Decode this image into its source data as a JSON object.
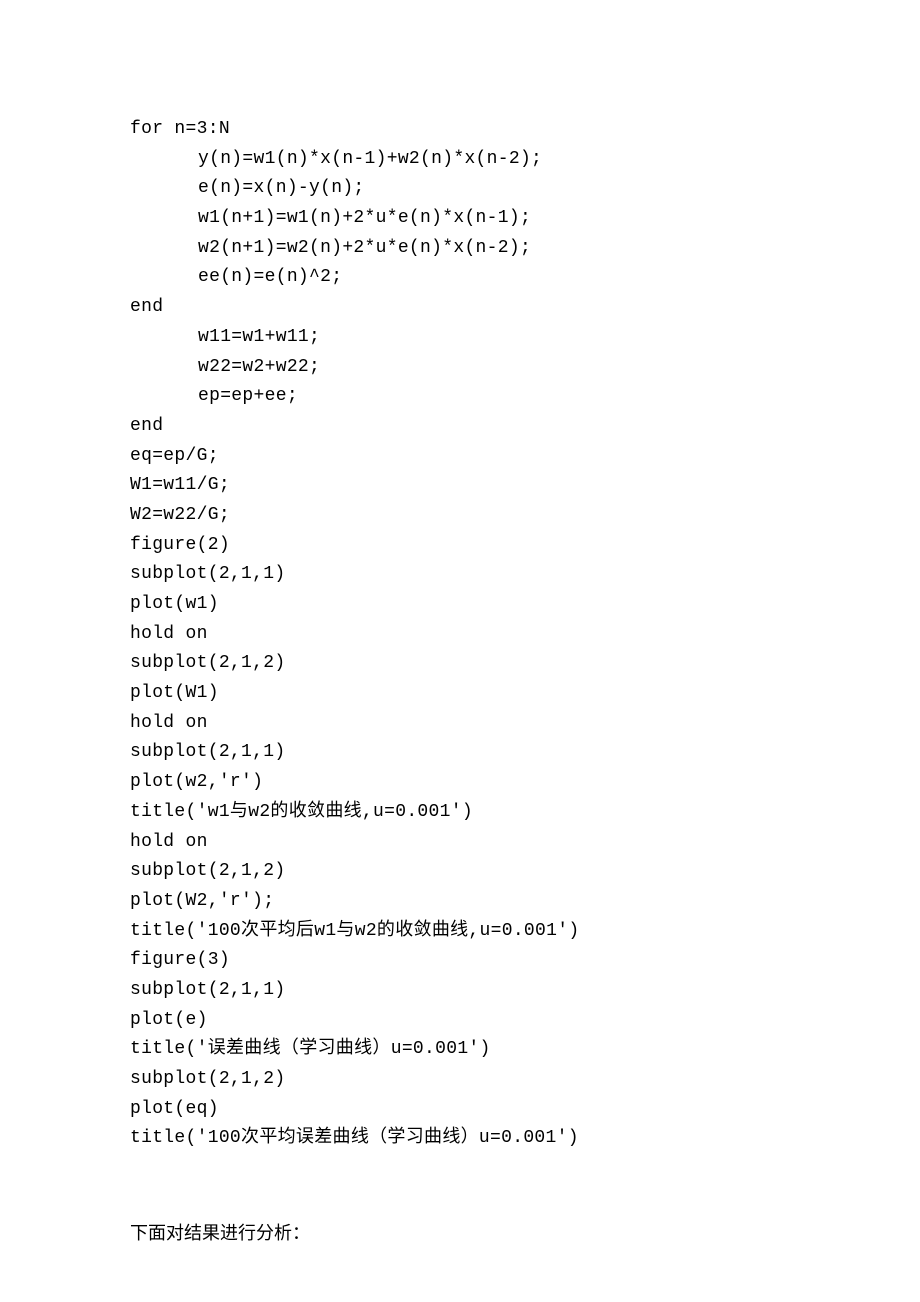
{
  "code_lines": [
    {
      "text": "for n=3:N",
      "indent": false
    },
    {
      "text": "y(n)=w1(n)*x(n-1)+w2(n)*x(n-2);",
      "indent": true
    },
    {
      "text": "e(n)=x(n)-y(n);",
      "indent": true
    },
    {
      "text": "w1(n+1)=w1(n)+2*u*e(n)*x(n-1);",
      "indent": true
    },
    {
      "text": "w2(n+1)=w2(n)+2*u*e(n)*x(n-2);",
      "indent": true
    },
    {
      "text": "ee(n)=e(n)^2;",
      "indent": true
    },
    {
      "text": "end",
      "indent": false
    },
    {
      "text": "w11=w1+w11;",
      "indent": true
    },
    {
      "text": "w22=w2+w22;",
      "indent": true
    },
    {
      "text": "ep=ep+ee;",
      "indent": true
    },
    {
      "text": "end",
      "indent": false
    },
    {
      "text": "eq=ep/G;",
      "indent": false
    },
    {
      "text": "W1=w11/G;",
      "indent": false
    },
    {
      "text": "W2=w22/G;",
      "indent": false
    },
    {
      "text": "figure(2)",
      "indent": false
    },
    {
      "text": "subplot(2,1,1)",
      "indent": false
    },
    {
      "text": "plot(w1)",
      "indent": false
    },
    {
      "text": "hold on",
      "indent": false
    },
    {
      "text": "subplot(2,1,2)",
      "indent": false
    },
    {
      "text": "plot(W1)",
      "indent": false
    },
    {
      "text": "hold on",
      "indent": false
    },
    {
      "text": "subplot(2,1,1)",
      "indent": false
    },
    {
      "text": "plot(w2,'r')",
      "indent": false
    },
    {
      "text": "title('w1与w2的收敛曲线,u=0.001')",
      "indent": false
    },
    {
      "text": "hold on",
      "indent": false
    },
    {
      "text": "subplot(2,1,2)",
      "indent": false
    },
    {
      "text": "plot(W2,'r');",
      "indent": false
    },
    {
      "text": "title('100次平均后w1与w2的收敛曲线,u=0.001')",
      "indent": false
    },
    {
      "text": "figure(3)",
      "indent": false
    },
    {
      "text": "subplot(2,1,1)",
      "indent": false
    },
    {
      "text": "plot(e)",
      "indent": false
    },
    {
      "text": "title('误差曲线（学习曲线）u=0.001')",
      "indent": false
    },
    {
      "text": "subplot(2,1,2)",
      "indent": false
    },
    {
      "text": "plot(eq)",
      "indent": false
    },
    {
      "text": "title('100次平均误差曲线（学习曲线）u=0.001')",
      "indent": false
    }
  ],
  "footer": "下面对结果进行分析："
}
